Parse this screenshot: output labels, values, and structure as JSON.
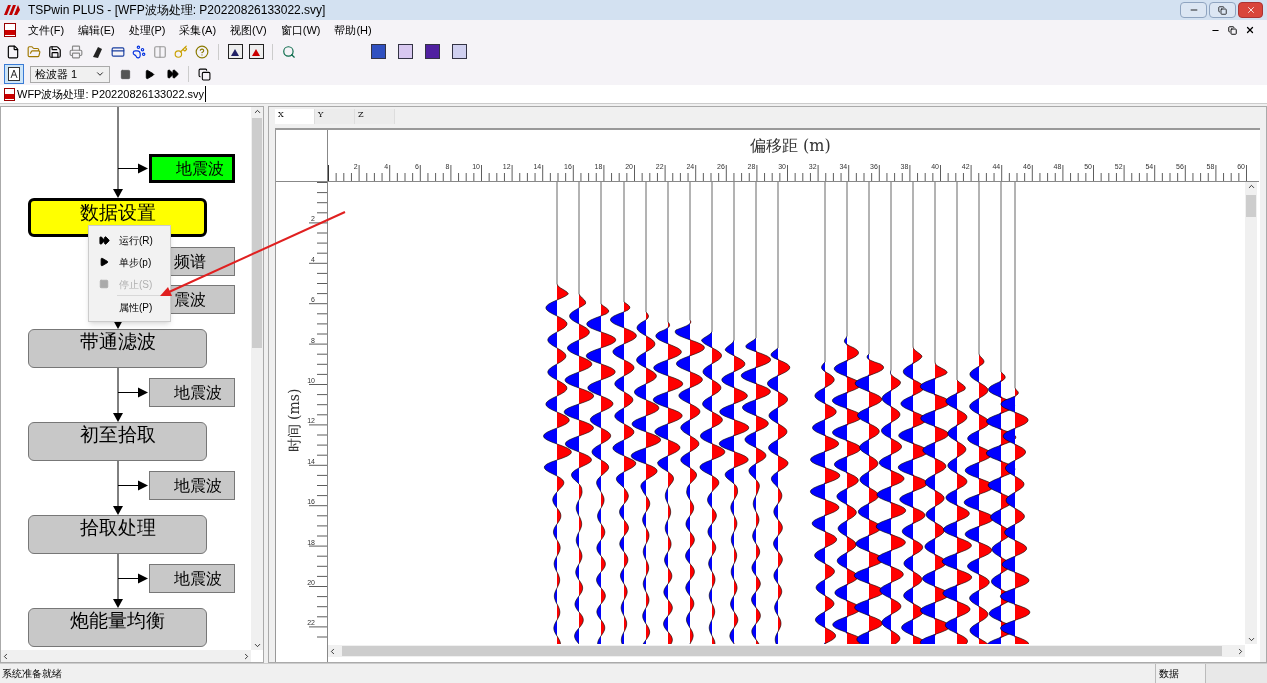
{
  "window": {
    "title": "TSPwin PLUS - [WFP波场处理: P20220826133022.svy]"
  },
  "menu": [
    "文件(F)",
    "编辑(E)",
    "处理(P)",
    "采集(A)",
    "视图(V)",
    "窗口(W)",
    "帮助(H)"
  ],
  "toolbar": {
    "mode_button": {
      "selected": true
    },
    "detector_select": {
      "value": "检波器 1"
    }
  },
  "document_tab": {
    "label": "WFP波场处理: P20220826133022.svy"
  },
  "flowchart": {
    "nodes": [
      {
        "kind": "output",
        "label": "地震波",
        "highlighted": true
      },
      {
        "kind": "process",
        "label": "数据设置",
        "highlighted": true
      },
      {
        "kind": "output",
        "label": "频谱",
        "highlighted": false
      },
      {
        "kind": "output",
        "label": "震波",
        "highlighted": false
      },
      {
        "kind": "process",
        "label": "带通滤波",
        "highlighted": false
      },
      {
        "kind": "output",
        "label": "地震波",
        "highlighted": false
      },
      {
        "kind": "process",
        "label": "初至拾取",
        "highlighted": false
      },
      {
        "kind": "output",
        "label": "地震波",
        "highlighted": false
      },
      {
        "kind": "process",
        "label": "拾取处理",
        "highlighted": false
      },
      {
        "kind": "output",
        "label": "地震波",
        "highlighted": false
      },
      {
        "kind": "process",
        "label": "炮能量均衡",
        "highlighted": false
      }
    ]
  },
  "context_menu": {
    "items": [
      {
        "kind": "run",
        "label": "运行(R)",
        "disabled": false,
        "separator_before": false
      },
      {
        "kind": "step",
        "label": "单步(p)",
        "disabled": false,
        "separator_before": false
      },
      {
        "kind": "stop",
        "label": "停止(S)",
        "disabled": true,
        "separator_before": false
      },
      {
        "kind": "plain",
        "label": "属性(P)",
        "disabled": false,
        "separator_before": true
      }
    ]
  },
  "plot": {
    "tabs": [
      {
        "label": "X",
        "selected": true
      },
      {
        "label": "Y",
        "selected": false
      },
      {
        "label": "Z",
        "selected": false
      }
    ],
    "x_axis": {
      "title": "偏移距 (m)",
      "ticks": [
        "2",
        "4",
        "6",
        "8",
        "10",
        "12",
        "14",
        "16",
        "18",
        "20",
        "22",
        "24",
        "26",
        "28",
        "30",
        "32",
        "34",
        "36",
        "38",
        "40",
        "42",
        "44",
        "46",
        "48",
        "50",
        "52",
        "54",
        "56",
        "58",
        "60"
      ]
    },
    "y_axis": {
      "title": "时间 (ms)",
      "ticks": [
        "2",
        "4",
        "6",
        "8",
        "10",
        "12",
        "14",
        "16",
        "18",
        "20",
        "22"
      ]
    }
  },
  "status_bar": {
    "message": "系统准备就绪",
    "panels": [
      "数据"
    ]
  }
}
